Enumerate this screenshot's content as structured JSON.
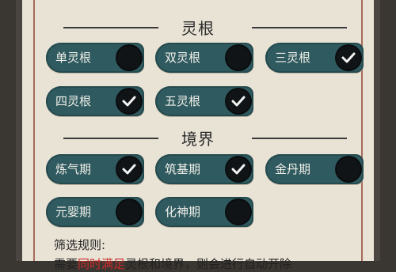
{
  "sections": [
    {
      "title": "灵根",
      "items": [
        {
          "label": "单灵根",
          "checked": false
        },
        {
          "label": "双灵根",
          "checked": false
        },
        {
          "label": "三灵根",
          "checked": true
        },
        {
          "label": "四灵根",
          "checked": true
        },
        {
          "label": "五灵根",
          "checked": true
        }
      ]
    },
    {
      "title": "境界",
      "items": [
        {
          "label": "炼气期",
          "checked": true
        },
        {
          "label": "筑基期",
          "checked": true
        },
        {
          "label": "金丹期",
          "checked": false
        },
        {
          "label": "元婴期",
          "checked": false
        },
        {
          "label": "化神期",
          "checked": false
        }
      ]
    }
  ],
  "rules": {
    "title": "筛选规则:",
    "text_prefix": "需要",
    "text_highlight": "同时满足",
    "text_suffix": "灵根和境界，则会进行自动开除"
  },
  "colors": {
    "panel_bg": "#e9e3d6",
    "toggle_bg": "#2f5a5f",
    "knob": "#101417",
    "highlight": "#cc2b2b"
  }
}
